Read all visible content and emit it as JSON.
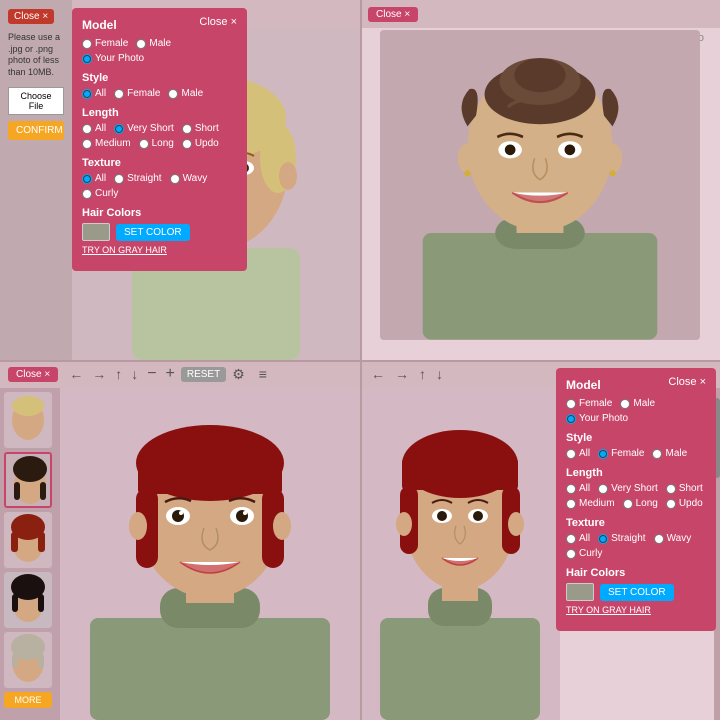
{
  "upload_panel": {
    "close_label": "Close ×",
    "instruction": "Please use a .jpg or .png photo of less than 10MB.",
    "choose_file_label": "Choose File",
    "confirm_label": "CONFIRM"
  },
  "top_left_panel": {
    "close_label": "Close ×",
    "title": "Model",
    "model_options": [
      "Female",
      "Male",
      "Your Photo"
    ],
    "style_title": "Style",
    "style_options": [
      "All",
      "Female",
      "Male"
    ],
    "length_title": "Length",
    "length_options": [
      "All",
      "Very Short",
      "Short",
      "Medium",
      "Long",
      "Updo"
    ],
    "texture_title": "Texture",
    "texture_options": [
      "All",
      "Straight",
      "Wavy",
      "Curly"
    ],
    "hair_colors_title": "Hair Colors",
    "set_color_label": "SET COLOR",
    "try_gray_label": "TRY ON GRAY HAIR"
  },
  "top_right": {
    "close_label": "Close ×",
    "your_photo_label": "Your Photo"
  },
  "bottom_left": {
    "close_label": "Close ×",
    "reset_label": "RESET",
    "more_label": "MORE"
  },
  "bottom_right_panel": {
    "close_label": "Close ×",
    "title": "Model",
    "model_options": [
      "Female",
      "Male",
      "Your Photo"
    ],
    "style_title": "Style",
    "style_options": [
      "All",
      "Female",
      "Male"
    ],
    "length_title": "Length",
    "length_options": [
      "All",
      "Very Short",
      "Short",
      "Medium",
      "Long",
      "Updo"
    ],
    "texture_title": "Texture",
    "texture_options": [
      "All",
      "Straight",
      "Wavy",
      "Curly"
    ],
    "hair_colors_title": "Hair Colors",
    "set_color_label": "SET COLOR",
    "try_gray_label": "TRY ON GRAY HAIR"
  },
  "colors": {
    "panel_bg": "#c8456a",
    "accent_blue": "#00aaff",
    "accent_orange": "#f5a623",
    "bg_pink": "#e8d0d8"
  },
  "toolbar": {
    "minus": "−",
    "plus": "+",
    "reset": "RESET",
    "hamburger": "≡"
  }
}
